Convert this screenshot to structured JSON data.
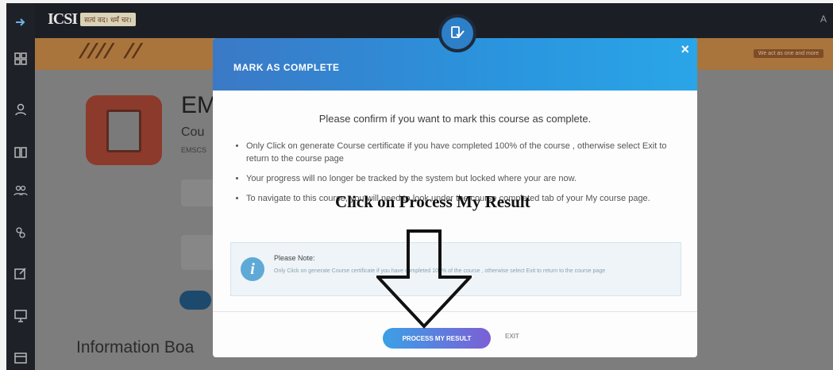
{
  "header": {
    "logo_mark": "ICSI",
    "logo_tagline": "सत्यं वद। धर्मं चर।",
    "right_text": "A"
  },
  "banner": {
    "right_tag": "We act as one and more"
  },
  "sidebar": {
    "icons": [
      "menu-arrow-icon",
      "dashboard-grid-icon",
      "user-icon",
      "book-icon",
      "group-icon",
      "users-icon",
      "edit-icon",
      "presentation-icon",
      "calendar-icon"
    ]
  },
  "course": {
    "title": "EM",
    "subtitle": "Cou",
    "code": "EMSCS"
  },
  "page": {
    "info_board_title": "Information Boa"
  },
  "modal": {
    "title": "MARK AS COMPLETE",
    "close_symbol": "×",
    "confirm_text": "Please confirm if you want to mark this course as complete.",
    "bullets": [
      "Only Click on generate Course certificate if you have completed 100% of the course , otherwise select Exit to return to the course page",
      "Your progress will no longer be tracked by the system but locked where your are now.",
      "To navigate to this course, you will need to look under the course completed tab of your My course page."
    ],
    "note": {
      "title": "Please Note:",
      "text": "Only Click on generate Course certificate if you have completed 100% of the course , otherwise select Exit to return to the course page"
    },
    "buttons": {
      "process": "PROCESS MY RESULT",
      "exit": "EXIT"
    }
  },
  "annotation": {
    "text": "Click on Process My Result"
  },
  "colors": {
    "modal_header_start": "#3b79c6",
    "modal_header_end": "#2aa5e8",
    "process_button_start": "#3ba0e6",
    "process_button_end": "#7c5fd6",
    "sidebar_bg": "#1f2129"
  }
}
